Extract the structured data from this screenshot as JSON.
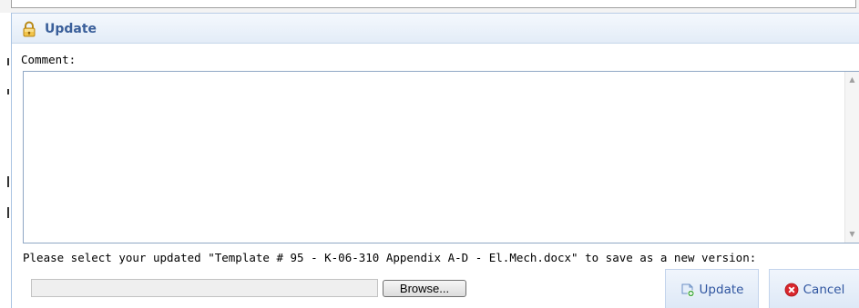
{
  "dialog": {
    "title": "Update",
    "comment_label": "Comment:",
    "comment_value": "",
    "instruction": "Please select your updated \"Template # 95 - K-06-310 Appendix A-D - El.Mech.docx\" to save as a new version:",
    "file_value": "",
    "browse_label": "Browse...",
    "update_label": "Update",
    "cancel_label": "Cancel"
  },
  "icons": {
    "title_icon": "padlock-icon",
    "update_icon": "update-document-icon",
    "cancel_icon": "cancel-icon"
  },
  "colors": {
    "title_text": "#3a5f9a",
    "button_text": "#2f55a0",
    "cancel_red": "#d9262c"
  }
}
